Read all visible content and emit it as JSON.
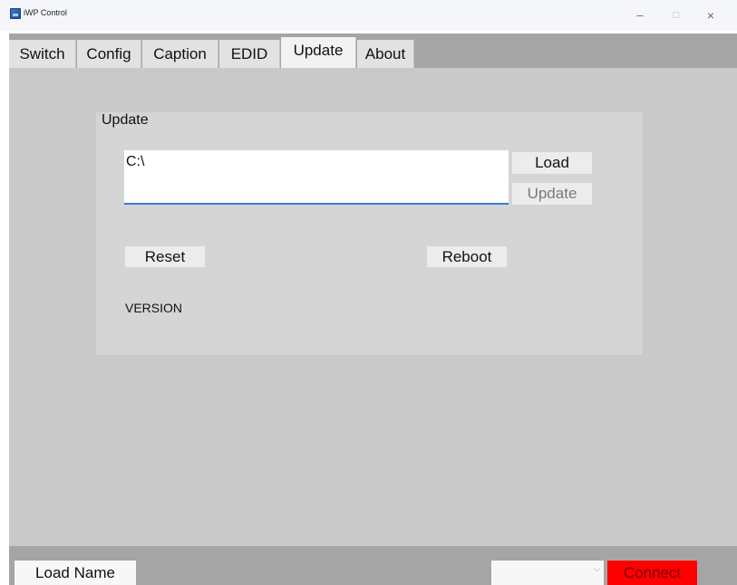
{
  "window": {
    "title": "iWP Control",
    "controls": {
      "minimize": "–",
      "maximize": "□",
      "close": "×"
    }
  },
  "tabs": [
    {
      "label": "Switch",
      "active": false
    },
    {
      "label": "Config",
      "active": false
    },
    {
      "label": "Caption",
      "active": false
    },
    {
      "label": "EDID",
      "active": false
    },
    {
      "label": "Update",
      "active": true
    },
    {
      "label": "About",
      "active": false
    }
  ],
  "update_panel": {
    "title": "Update",
    "path_value": "C:\\",
    "load_label": "Load",
    "update_label": "Update",
    "reset_label": "Reset",
    "reboot_label": "Reboot",
    "version_label": "VERSION"
  },
  "footer": {
    "load_name_label": "Load Name",
    "port_select_value": "",
    "connect_label": "Connect"
  },
  "colors": {
    "tabbar_bg": "#a5a5a5",
    "content_bg": "#c9c9c9",
    "group_bg": "#d5d5d5",
    "input_underline": "#3c7ad6",
    "connect_bg": "#ff0000"
  },
  "icons": {
    "app": "app-icon",
    "combo": "chevron-down-icon"
  }
}
